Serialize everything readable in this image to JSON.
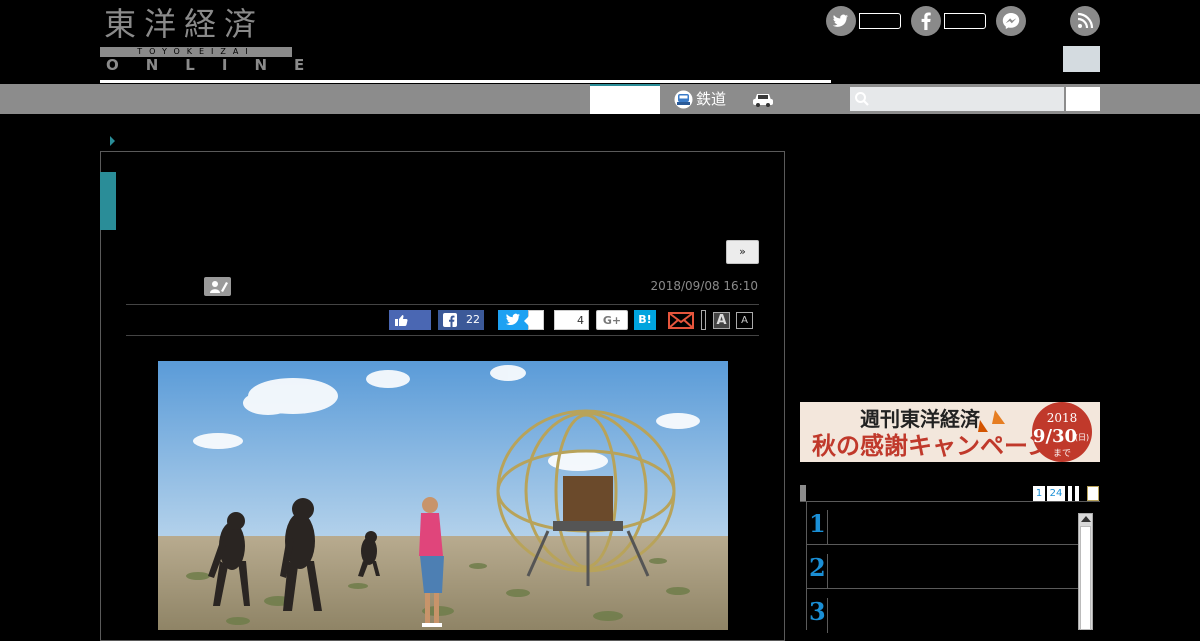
{
  "logo": {
    "kanji": "東洋経済",
    "sub": "TOYOKEIZAI",
    "online": "ONLINE"
  },
  "nav": {
    "items": [
      {
        "icon": "train-icon",
        "label": "鉄道"
      },
      {
        "icon": "car-icon",
        "label": ""
      }
    ]
  },
  "article": {
    "next_label": "»",
    "date": "2018/09/08 16:10",
    "share": {
      "facebook_count": "22",
      "hatena_label": "B!",
      "pocket_count": "4",
      "gplus_label": "G+",
      "font_large": "A",
      "font_small": "A"
    }
  },
  "sidebar": {
    "banner": {
      "line1": "週刊東洋経済",
      "line2": "秋の感謝キャンペーン",
      "badge_year": "2018",
      "badge_date": "9/30",
      "badge_day": "(日)",
      "badge_until": "まで"
    },
    "ranking": {
      "tabs": [
        "1",
        "24"
      ],
      "rows": [
        {
          "num": "1"
        },
        {
          "num": "2"
        },
        {
          "num": "3"
        }
      ]
    }
  },
  "colors": {
    "accent": "#2a8d98",
    "nav_gray": "#8c8c8c",
    "rank_blue": "#1a8fd6",
    "banner_red": "#c0392b"
  }
}
